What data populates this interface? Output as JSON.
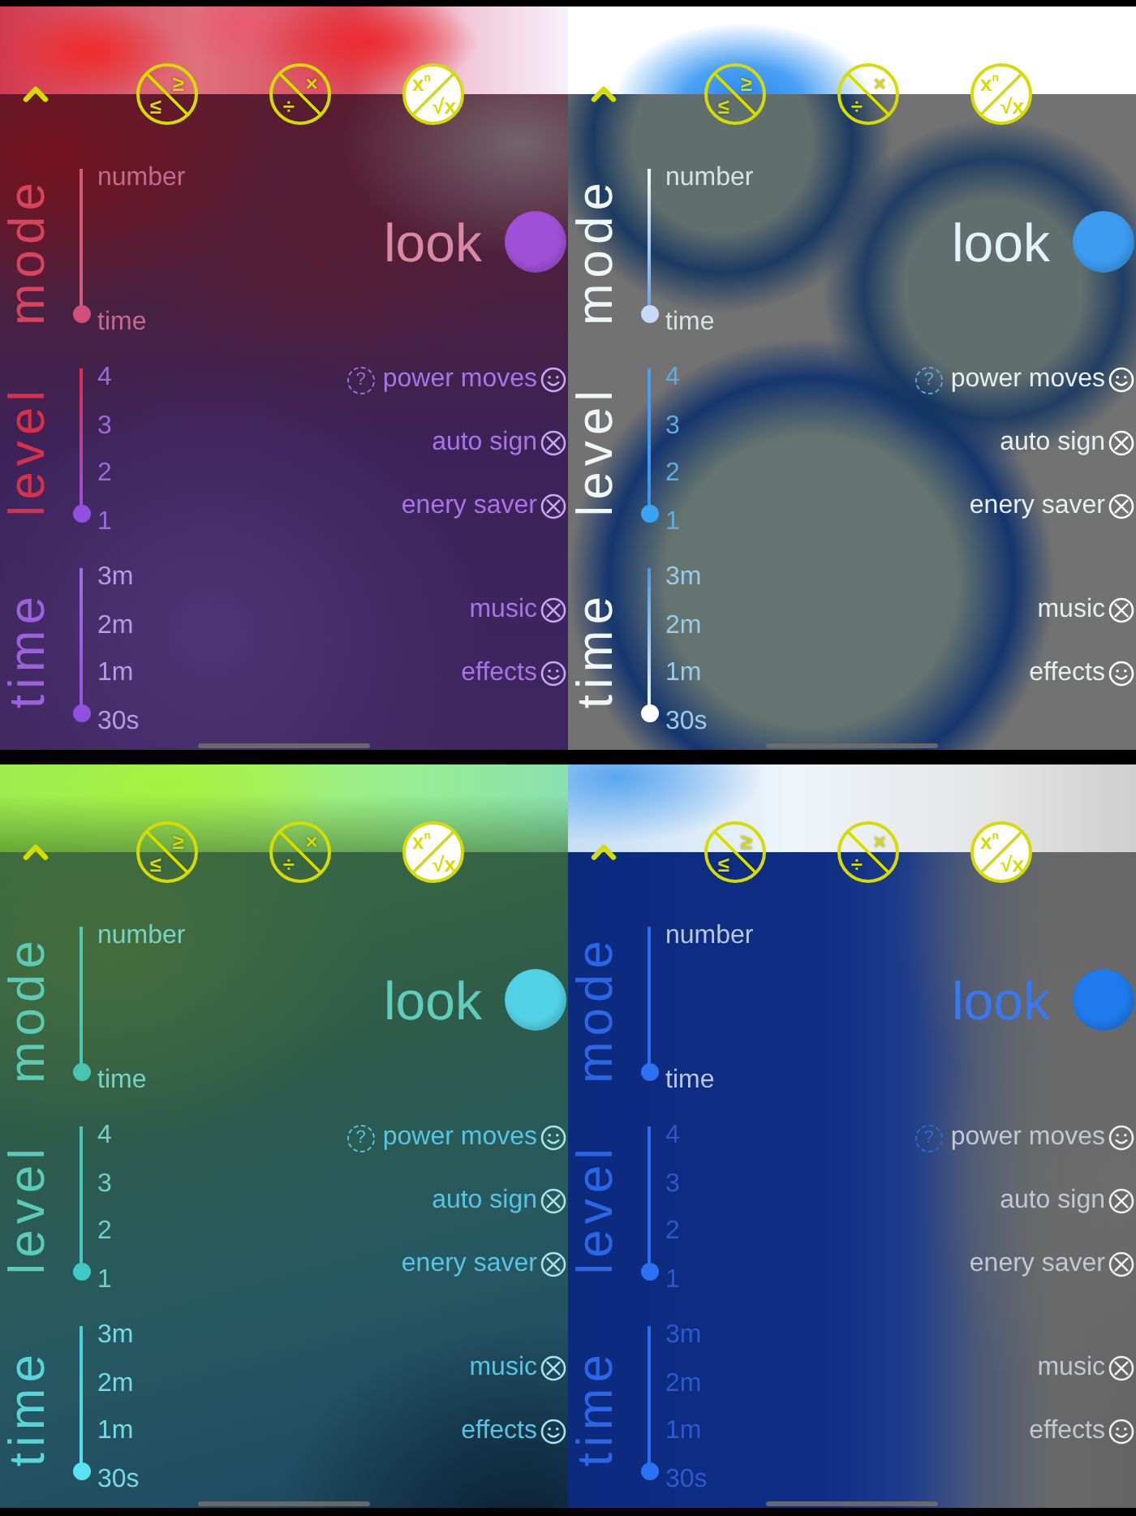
{
  "screens": [
    {
      "kind": "ember",
      "operations": [
        {
          "upper": "≥",
          "lower": "≤",
          "kind": "falling",
          "selected": false
        },
        {
          "upper": "×",
          "lower": "÷",
          "kind": "falling",
          "selected": false
        },
        {
          "upper": "x$^{n}$",
          "lower": "√x",
          "kind": "rising",
          "selected": true
        }
      ],
      "sliders": [
        {
          "label": "mode",
          "stops": [
            {
              "label": "number",
              "selected": false
            },
            {
              "label": "time",
              "selected": true
            }
          ]
        },
        {
          "label": "level",
          "stops": [
            {
              "label": "4",
              "selected": false
            },
            {
              "label": "3",
              "selected": false
            },
            {
              "label": "2",
              "selected": false
            },
            {
              "label": "1",
              "selected": true
            }
          ]
        },
        {
          "label": "time",
          "stops": [
            {
              "label": "3m",
              "selected": false
            },
            {
              "label": "2m",
              "selected": false
            },
            {
              "label": "1m",
              "selected": false
            },
            {
              "label": "30s",
              "selected": true
            }
          ]
        }
      ],
      "look": {
        "label": "look",
        "color": "#a050d8"
      },
      "game_toggles": [
        {
          "help": "?",
          "label": "power moves",
          "on": true
        },
        {
          "label": "auto sign",
          "on": false
        },
        {
          "label": "enery saver",
          "on": false
        }
      ],
      "sound_toggles": [
        {
          "label": "music",
          "on": false
        },
        {
          "label": "effects",
          "on": true
        }
      ]
    },
    {
      "kind": "bubbles",
      "operations": [
        {
          "upper": "≥",
          "lower": "≤",
          "kind": "falling",
          "selected": false
        },
        {
          "upper": "×",
          "lower": "÷",
          "kind": "falling",
          "selected": false
        },
        {
          "upper": "x$^{n}$",
          "lower": "√x",
          "kind": "rising",
          "selected": true
        }
      ],
      "sliders": [
        {
          "label": "mode",
          "stops": [
            {
              "label": "number",
              "selected": false
            },
            {
              "label": "time",
              "selected": true
            }
          ]
        },
        {
          "label": "level",
          "stops": [
            {
              "label": "4",
              "selected": false
            },
            {
              "label": "3",
              "selected": false
            },
            {
              "label": "2",
              "selected": false
            },
            {
              "label": "1",
              "selected": true
            }
          ]
        },
        {
          "label": "time",
          "stops": [
            {
              "label": "3m",
              "selected": false
            },
            {
              "label": "2m",
              "selected": false
            },
            {
              "label": "1m",
              "selected": false
            },
            {
              "label": "30s",
              "selected": true
            }
          ]
        }
      ],
      "look": {
        "label": "look",
        "color": "#3c9cf0"
      },
      "game_toggles": [
        {
          "help": "?",
          "label": "power moves",
          "on": true
        },
        {
          "label": "auto sign",
          "on": false
        },
        {
          "label": "enery saver",
          "on": false
        }
      ],
      "sound_toggles": [
        {
          "label": "music",
          "on": false
        },
        {
          "label": "effects",
          "on": true
        }
      ]
    },
    {
      "kind": "meadow",
      "operations": [
        {
          "upper": "≥",
          "lower": "≤",
          "kind": "falling",
          "selected": false
        },
        {
          "upper": "×",
          "lower": "÷",
          "kind": "falling",
          "selected": false
        },
        {
          "upper": "x$^{n}$",
          "lower": "√x",
          "kind": "rising",
          "selected": true
        }
      ],
      "sliders": [
        {
          "label": "mode",
          "stops": [
            {
              "label": "number",
              "selected": false
            },
            {
              "label": "time",
              "selected": true
            }
          ]
        },
        {
          "label": "level",
          "stops": [
            {
              "label": "4",
              "selected": false
            },
            {
              "label": "3",
              "selected": false
            },
            {
              "label": "2",
              "selected": false
            },
            {
              "label": "1",
              "selected": true
            }
          ]
        },
        {
          "label": "time",
          "stops": [
            {
              "label": "3m",
              "selected": false
            },
            {
              "label": "2m",
              "selected": false
            },
            {
              "label": "1m",
              "selected": false
            },
            {
              "label": "30s",
              "selected": true
            }
          ]
        }
      ],
      "look": {
        "label": "look",
        "color": "#52d2e6"
      },
      "game_toggles": [
        {
          "help": "?",
          "label": "power moves",
          "on": true
        },
        {
          "label": "auto sign",
          "on": false
        },
        {
          "label": "enery saver",
          "on": false
        }
      ],
      "sound_toggles": [
        {
          "label": "music",
          "on": false
        },
        {
          "label": "effects",
          "on": true
        }
      ]
    },
    {
      "kind": "ocean",
      "operations": [
        {
          "upper": "≥",
          "lower": "≤",
          "kind": "falling",
          "selected": false
        },
        {
          "upper": "×",
          "lower": "÷",
          "kind": "falling",
          "selected": false
        },
        {
          "upper": "x$^{n}$",
          "lower": "√x",
          "kind": "rising",
          "selected": true
        }
      ],
      "sliders": [
        {
          "label": "mode",
          "stops": [
            {
              "label": "number",
              "selected": false
            },
            {
              "label": "time",
              "selected": true
            }
          ]
        },
        {
          "label": "level",
          "stops": [
            {
              "label": "4",
              "selected": false
            },
            {
              "label": "3",
              "selected": false
            },
            {
              "label": "2",
              "selected": false
            },
            {
              "label": "1",
              "selected": true
            }
          ]
        },
        {
          "label": "time",
          "stops": [
            {
              "label": "3m",
              "selected": false
            },
            {
              "label": "2m",
              "selected": false
            },
            {
              "label": "1m",
              "selected": false
            },
            {
              "label": "30s",
              "selected": true
            }
          ]
        }
      ],
      "look": {
        "label": "look",
        "color": "#1f7aee"
      },
      "game_toggles": [
        {
          "help": "?",
          "label": "power moves",
          "on": true
        },
        {
          "label": "auto sign",
          "on": false
        },
        {
          "label": "enery saver",
          "on": false
        }
      ],
      "sound_toggles": [
        {
          "label": "music",
          "on": false
        },
        {
          "label": "effects",
          "on": true
        }
      ]
    }
  ]
}
